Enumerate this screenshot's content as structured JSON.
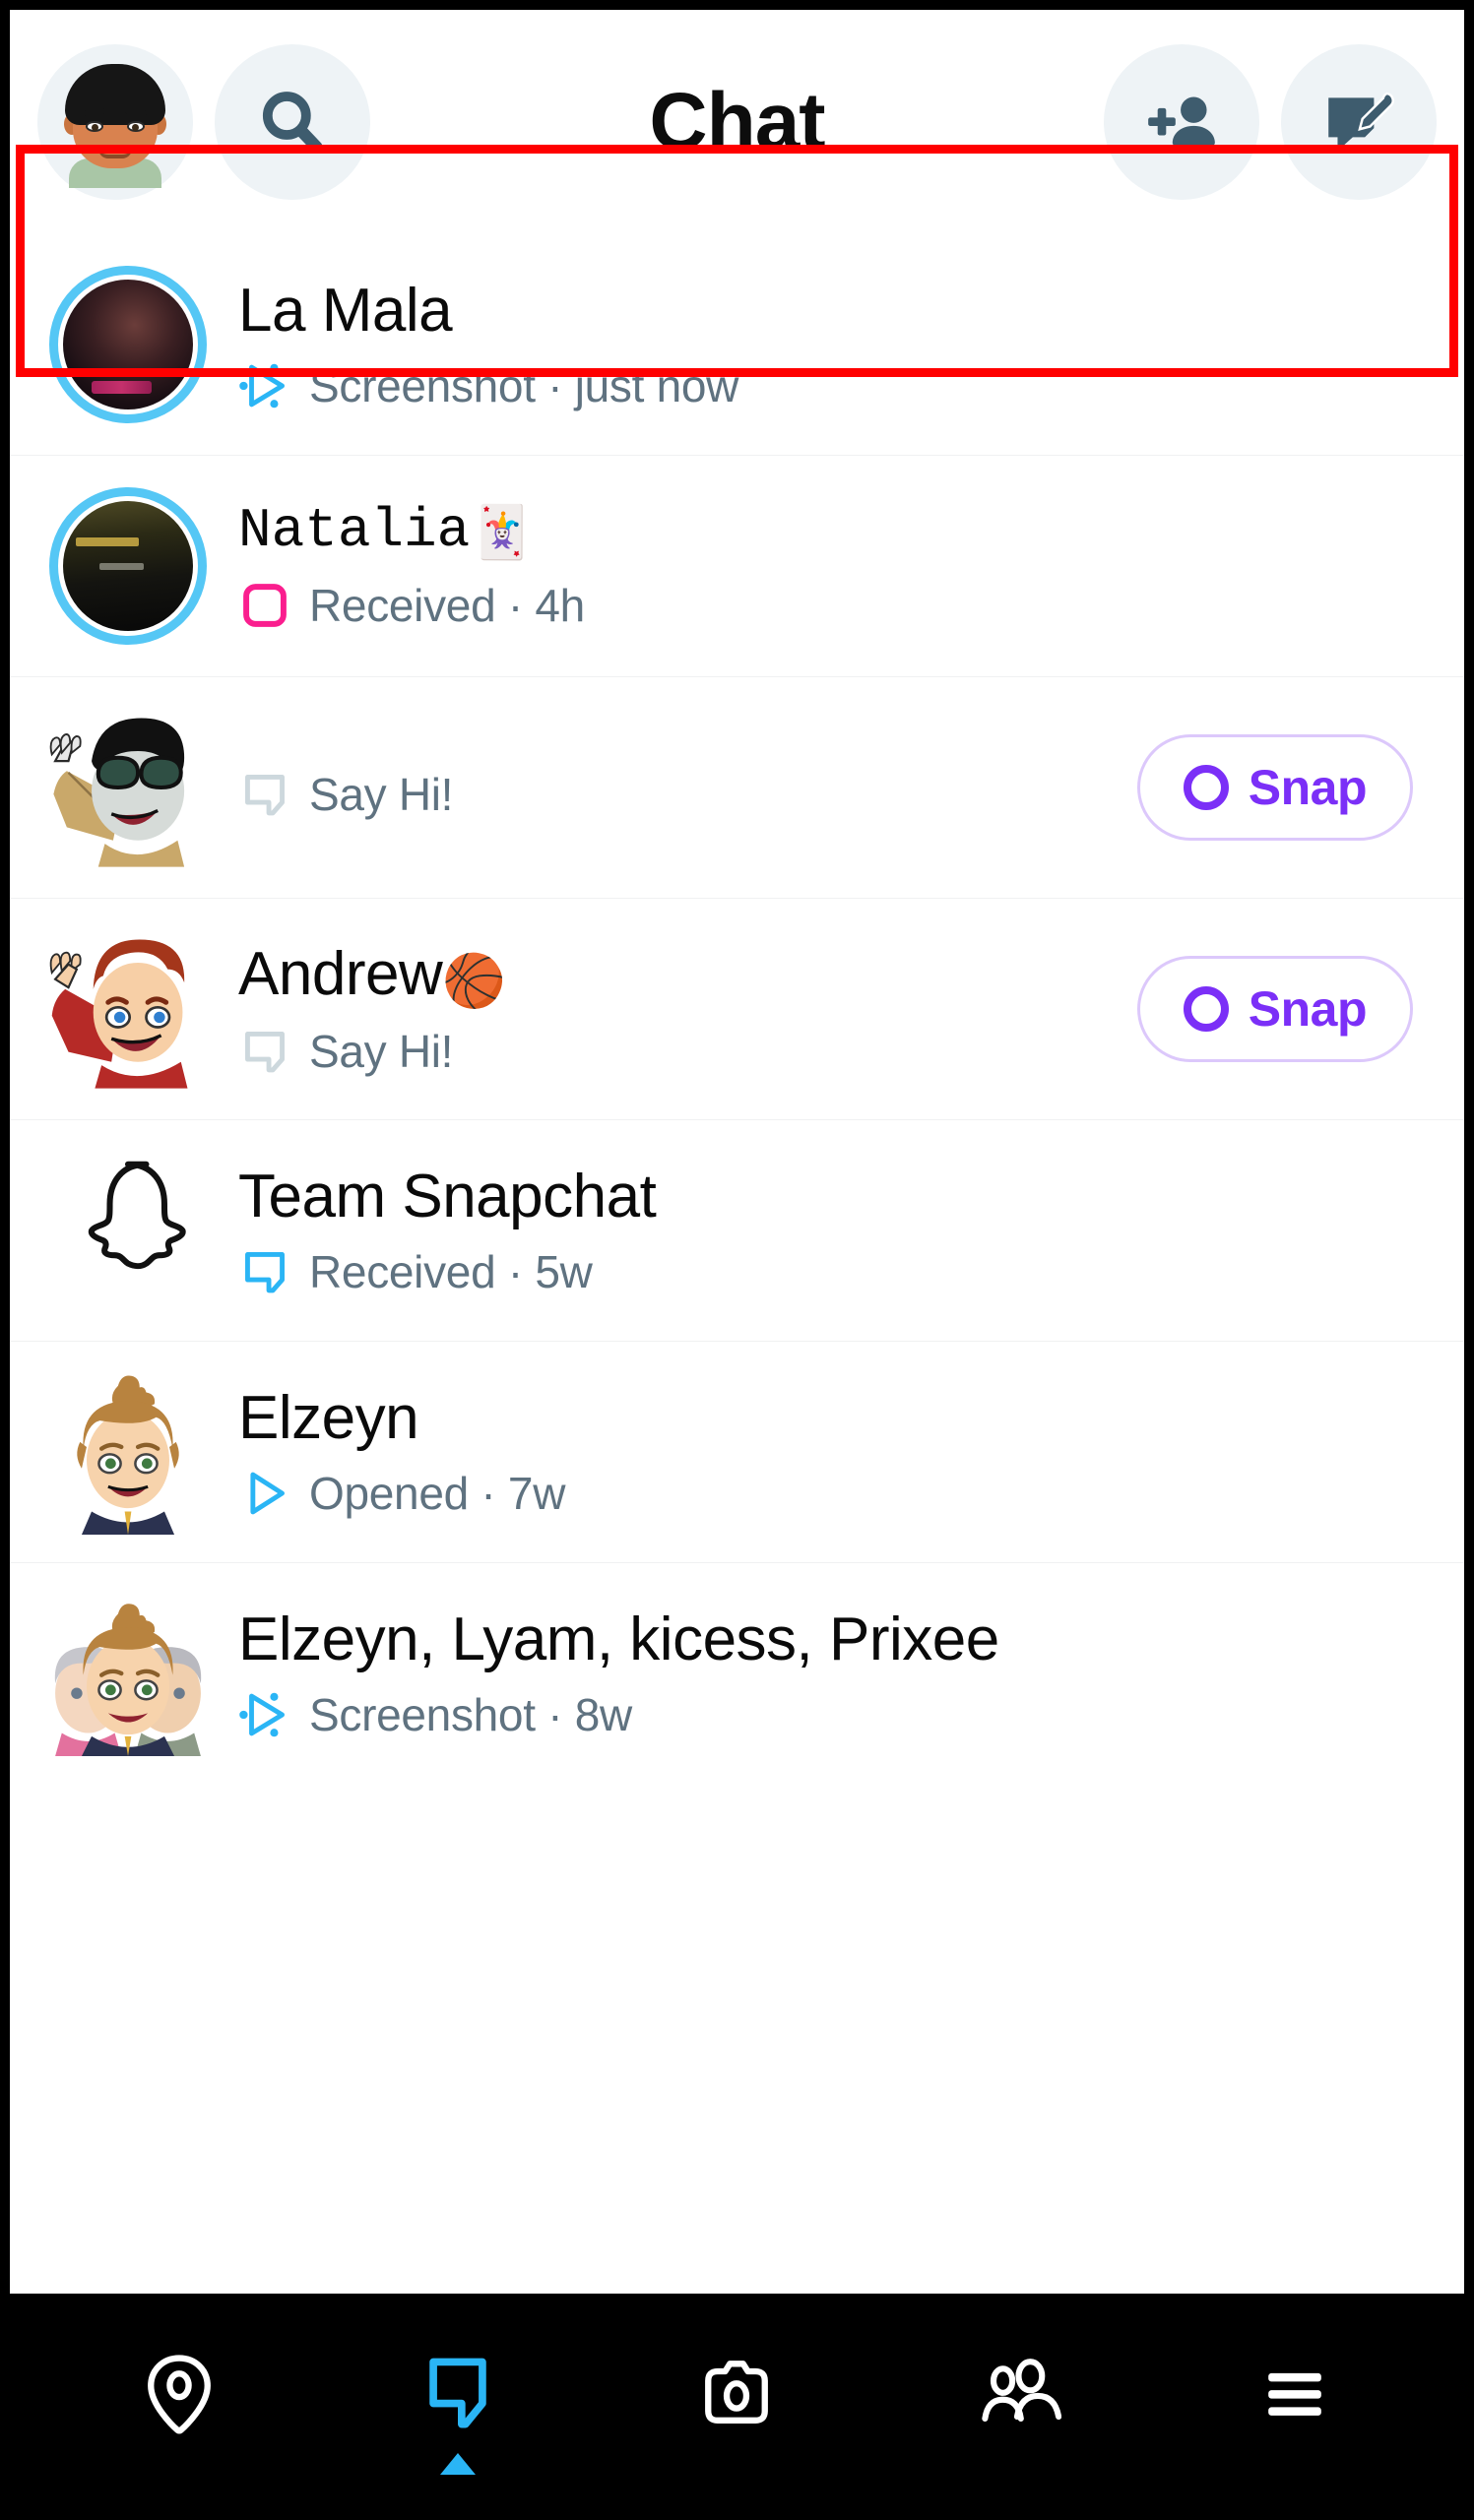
{
  "app": {
    "screen_title": "Chat"
  },
  "header": {
    "title": "Chat",
    "profile_avatar": "bitmoji-avatar",
    "search_icon": "search-icon",
    "add_friend_icon": "add-friend-icon",
    "new_chat_icon": "new-chat-icon"
  },
  "colors": {
    "snap_purple": "#7b2ff7",
    "snap_purple_border": "#dcc8fb",
    "story_ring_blue": "#55c7f5",
    "cyan": "#2ab5f5",
    "pink": "#fa1e8e",
    "gray_text": "#5f7280",
    "highlight_red": "#ff0000",
    "nav_background": "#000000",
    "header_icon_bg": "#eef3f6",
    "header_icon_fill": "#3e5c6e"
  },
  "highlight": {
    "present": true,
    "color": "#ff0000",
    "covers": [
      "La Mala",
      "Natalia"
    ]
  },
  "chats": [
    {
      "name": "La Mala",
      "emoji": "",
      "status": "Screenshot",
      "separator": "·",
      "time": "just now",
      "status_icon": "screenshot-arrow-icon",
      "status_icon_color": "#2ab5f5",
      "avatar_type": "photo-ring",
      "has_story_ring": true,
      "cta": null,
      "highlighted": true
    },
    {
      "name": "Natalia",
      "emoji": "🃏",
      "status": "Received",
      "separator": "·",
      "time": "4h",
      "status_icon": "square-outline-icon",
      "status_icon_color": "#fa1e8e",
      "avatar_type": "photo-ring",
      "has_story_ring": true,
      "cta": null,
      "highlighted": true
    },
    {
      "name": "",
      "emoji": "",
      "status": "Say Hi!",
      "separator": "",
      "time": "",
      "status_icon": "chat-bubble-icon",
      "status_icon_color": "#cdd8dd",
      "avatar_type": "bitmoji-sunglasses",
      "has_story_ring": false,
      "cta": "Snap",
      "highlighted": false
    },
    {
      "name": "Andrew",
      "emoji": "🏀",
      "status": "Say Hi!",
      "separator": "",
      "time": "",
      "status_icon": "chat-bubble-icon",
      "status_icon_color": "#cdd8dd",
      "avatar_type": "bitmoji-redhair",
      "has_story_ring": false,
      "cta": "Snap",
      "highlighted": false
    },
    {
      "name": "Team Snapchat",
      "emoji": "",
      "status": "Received",
      "separator": "·",
      "time": "5w",
      "status_icon": "chat-bubble-icon",
      "status_icon_color": "#2ab5f5",
      "avatar_type": "snapchat-ghost",
      "has_story_ring": false,
      "cta": null,
      "highlighted": false
    },
    {
      "name": "Elzeyn",
      "emoji": "",
      "status": "Opened",
      "separator": "·",
      "time": "7w",
      "status_icon": "opened-arrow-icon",
      "status_icon_color": "#2ab5f5",
      "avatar_type": "bitmoji-bun",
      "has_story_ring": false,
      "cta": null,
      "highlighted": false
    },
    {
      "name": "Elzeyn, Lyam, kicess, Prixee",
      "emoji": "",
      "status": "Screenshot",
      "separator": "·",
      "time": "8w",
      "status_icon": "screenshot-arrow-icon",
      "status_icon_color": "#2ab5f5",
      "avatar_type": "group-bitmoji",
      "has_story_ring": false,
      "cta": null,
      "highlighted": false
    }
  ],
  "snap_cta": {
    "label": "Snap",
    "icon": "snap-circle-icon"
  },
  "bottom_nav": {
    "active_index": 1,
    "items": [
      {
        "icon": "map-pin-icon",
        "name": "map-tab",
        "active": false
      },
      {
        "icon": "chat-bubble-icon",
        "name": "chat-tab",
        "active": true
      },
      {
        "icon": "camera-icon",
        "name": "camera-tab",
        "active": false
      },
      {
        "icon": "friends-icon",
        "name": "friends-tab",
        "active": false
      },
      {
        "icon": "hamburger-menu-icon",
        "name": "spotlight-tab",
        "active": false
      }
    ]
  }
}
